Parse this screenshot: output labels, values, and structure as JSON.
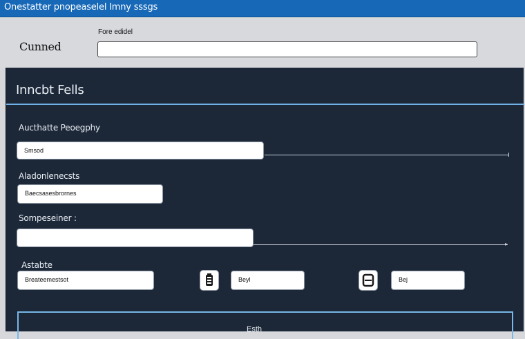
{
  "window": {
    "title": "Onestatter pnopeaselel Imny sssgs"
  },
  "toolbar": {
    "left_label": "Cunned",
    "field_label": "Fore edidel"
  },
  "panel": {
    "title": "Inncbt Fells",
    "fields": [
      {
        "label": "Aucthatte Peoegphy",
        "value": "Smsod"
      },
      {
        "label": "Aladonlenecsts",
        "value": "Baecsasesbrornes"
      },
      {
        "label": "Sompeseiner :",
        "value": ""
      },
      {
        "label": "Astabte",
        "values": [
          "Breateemestsot",
          "Beyl",
          "Bej"
        ]
      }
    ],
    "bottom_text": "Esth"
  },
  "icons": [
    "battery-icon",
    "save-icon"
  ]
}
